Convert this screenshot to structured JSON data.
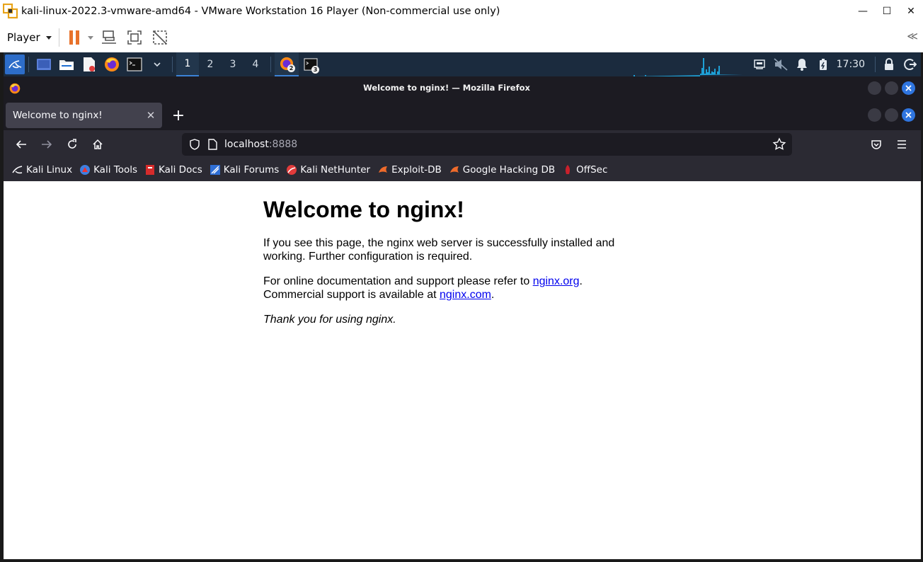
{
  "vmware": {
    "title": "kali-linux-2022.3-vmware-amd64 - VMware Workstation 16 Player (Non-commercial use only)",
    "player_menu": "Player",
    "collapse_glyph": "≪",
    "window_controls": {
      "minimize": "—",
      "maximize": "☐",
      "close": "✕"
    },
    "accent_color": "#e8722b"
  },
  "panel": {
    "workspaces": [
      "1",
      "2",
      "3",
      "4"
    ],
    "active_workspace": "1",
    "task_counts": {
      "firefox": "2",
      "terminal": "3"
    },
    "clock": "17:30",
    "panel_color": "#1b2b3e",
    "icons": [
      "kali-menu-icon",
      "desktop-icon",
      "file-manager-icon",
      "text-editor-icon",
      "firefox-icon",
      "terminal-icon",
      "network-icon",
      "mute-icon",
      "notification-icon",
      "battery-icon",
      "lock-icon",
      "logout-icon"
    ]
  },
  "firefox": {
    "window_title": "Welcome to nginx! — Mozilla Firefox",
    "tab_title": "Welcome to nginx!",
    "tab_close": "✕",
    "new_tab": "+",
    "url_host": "localhost",
    "url_port": ":8888",
    "bookmarks": [
      {
        "label": "Kali Linux",
        "icon": "kali-dragon-icon"
      },
      {
        "label": "Kali Tools",
        "icon": "kali-tools-icon"
      },
      {
        "label": "Kali Docs",
        "icon": "kali-docs-icon"
      },
      {
        "label": "Kali Forums",
        "icon": "kali-forums-icon"
      },
      {
        "label": "Kali NetHunter",
        "icon": "nethunter-icon"
      },
      {
        "label": "Exploit-DB",
        "icon": "exploit-db-icon"
      },
      {
        "label": "Google Hacking DB",
        "icon": "ghdb-icon"
      },
      {
        "label": "OffSec",
        "icon": "offsec-icon"
      }
    ]
  },
  "page": {
    "heading": "Welcome to nginx!",
    "p1": "If you see this page, the nginx web server is successfully installed and working. Further configuration is required.",
    "p2_before": "For online documentation and support please refer to ",
    "p2_link": "nginx.org",
    "p2_after": ".",
    "p2_line2_before": "Commercial support is available at ",
    "p2_line2_link": "nginx.com",
    "p2_line2_after": ".",
    "p3": "Thank you for using nginx."
  }
}
